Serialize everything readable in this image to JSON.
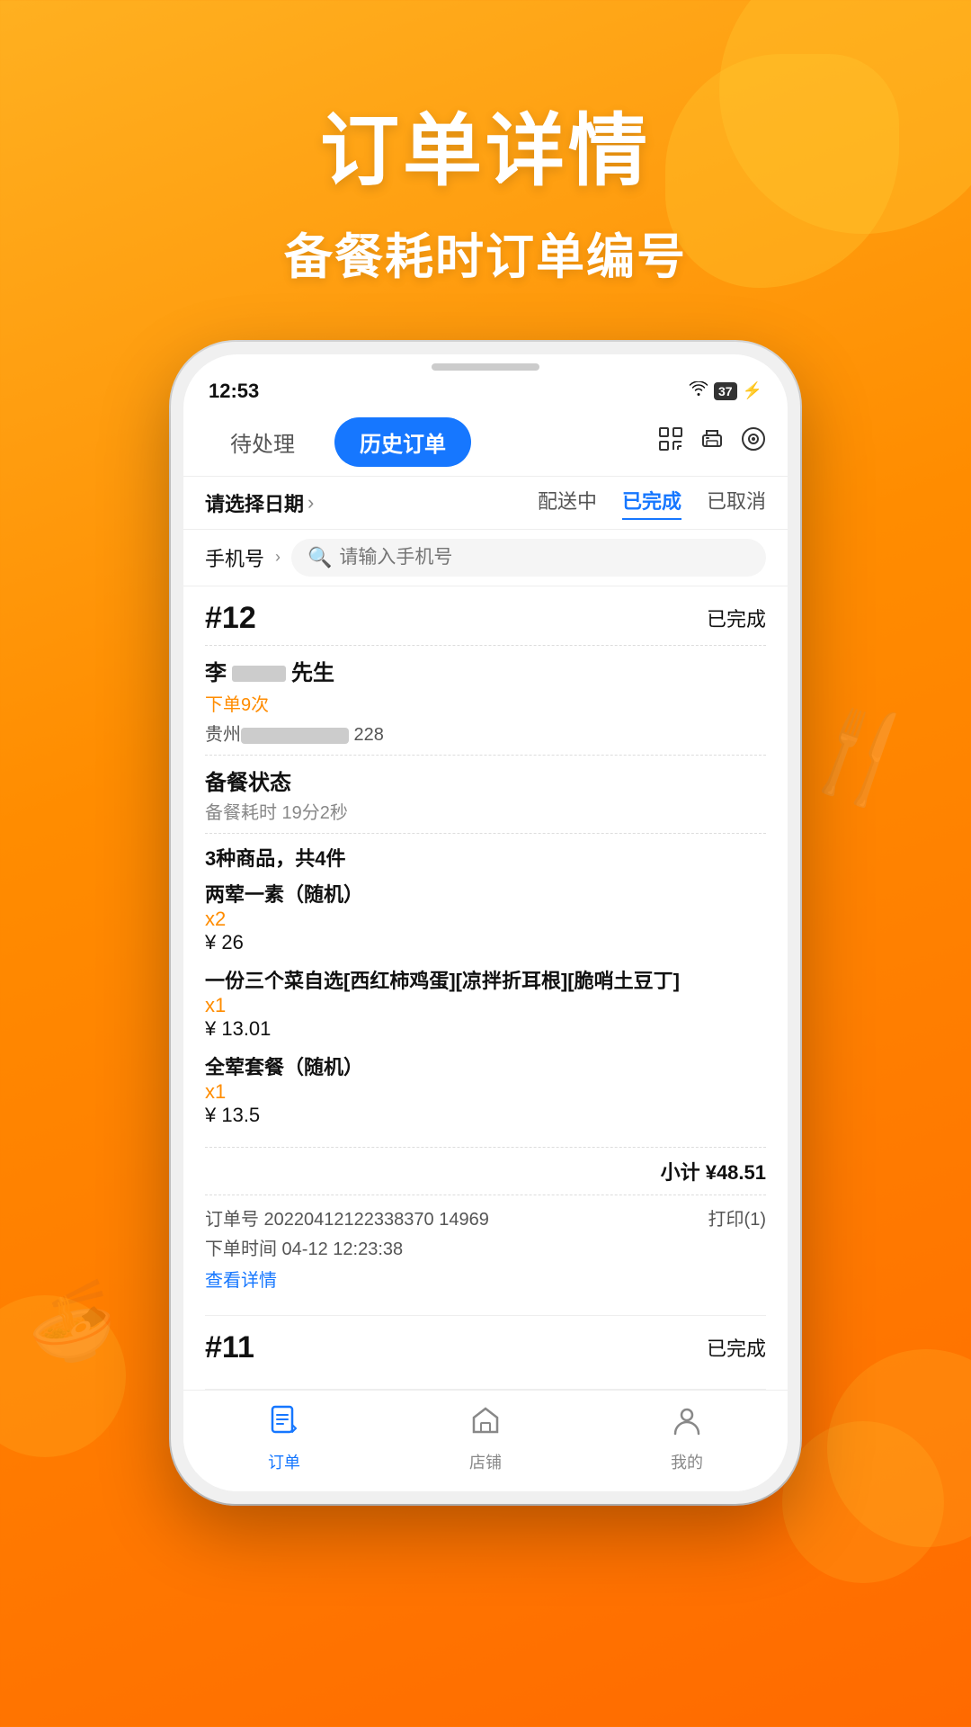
{
  "background": {
    "gradient_start": "#FFB020",
    "gradient_end": "#FF6A00"
  },
  "header": {
    "title": "订单详情",
    "subtitle": "备餐耗时订单编号"
  },
  "phone": {
    "status_bar": {
      "time": "12:53",
      "battery": "37",
      "wifi": true,
      "charging": true
    },
    "tabs": {
      "pending_label": "待处理",
      "history_label": "历史订单",
      "active": "历史订单"
    },
    "filters": {
      "date_label": "请选择日期",
      "statuses": [
        {
          "label": "配送中",
          "active": false
        },
        {
          "label": "已完成",
          "active": true
        },
        {
          "label": "已取消",
          "active": false
        }
      ]
    },
    "search": {
      "label": "手机号",
      "placeholder": "请输入手机号"
    },
    "orders": [
      {
        "number": "#12",
        "status": "已完成",
        "customer_name": "李      先生",
        "order_count": "下单9次",
        "region": "贵州",
        "address_suffix": "228",
        "prep_status": "备餐状态",
        "prep_time": "备餐耗时 19分2秒",
        "items_summary": "3种商品，共4件",
        "items": [
          {
            "name": "两荤一素（随机）",
            "qty": "x2",
            "price": "¥ 26"
          },
          {
            "name": "一份三个菜自选[西红柿鸡蛋][凉拌折耳根][脆哨土豆丁]",
            "qty": "x1",
            "price": "¥ 13.01"
          },
          {
            "name": "全荤套餐（随机）",
            "qty": "x1",
            "price": "¥ 13.5"
          }
        ],
        "subtotal_label": "小计",
        "subtotal": "¥48.51",
        "order_no_label": "订单号",
        "order_no": "20220412122338370 14969",
        "print_label": "打印(1)",
        "order_time_label": "下单时间",
        "order_time": "04-12 12:23:38",
        "view_detail": "查看详情"
      },
      {
        "number": "#11",
        "status": "已完成"
      }
    ],
    "bottom_nav": [
      {
        "label": "订单",
        "active": true,
        "icon": "📋"
      },
      {
        "label": "店铺",
        "active": false,
        "icon": "🏠"
      },
      {
        "label": "我的",
        "active": false,
        "icon": "😊"
      }
    ]
  }
}
